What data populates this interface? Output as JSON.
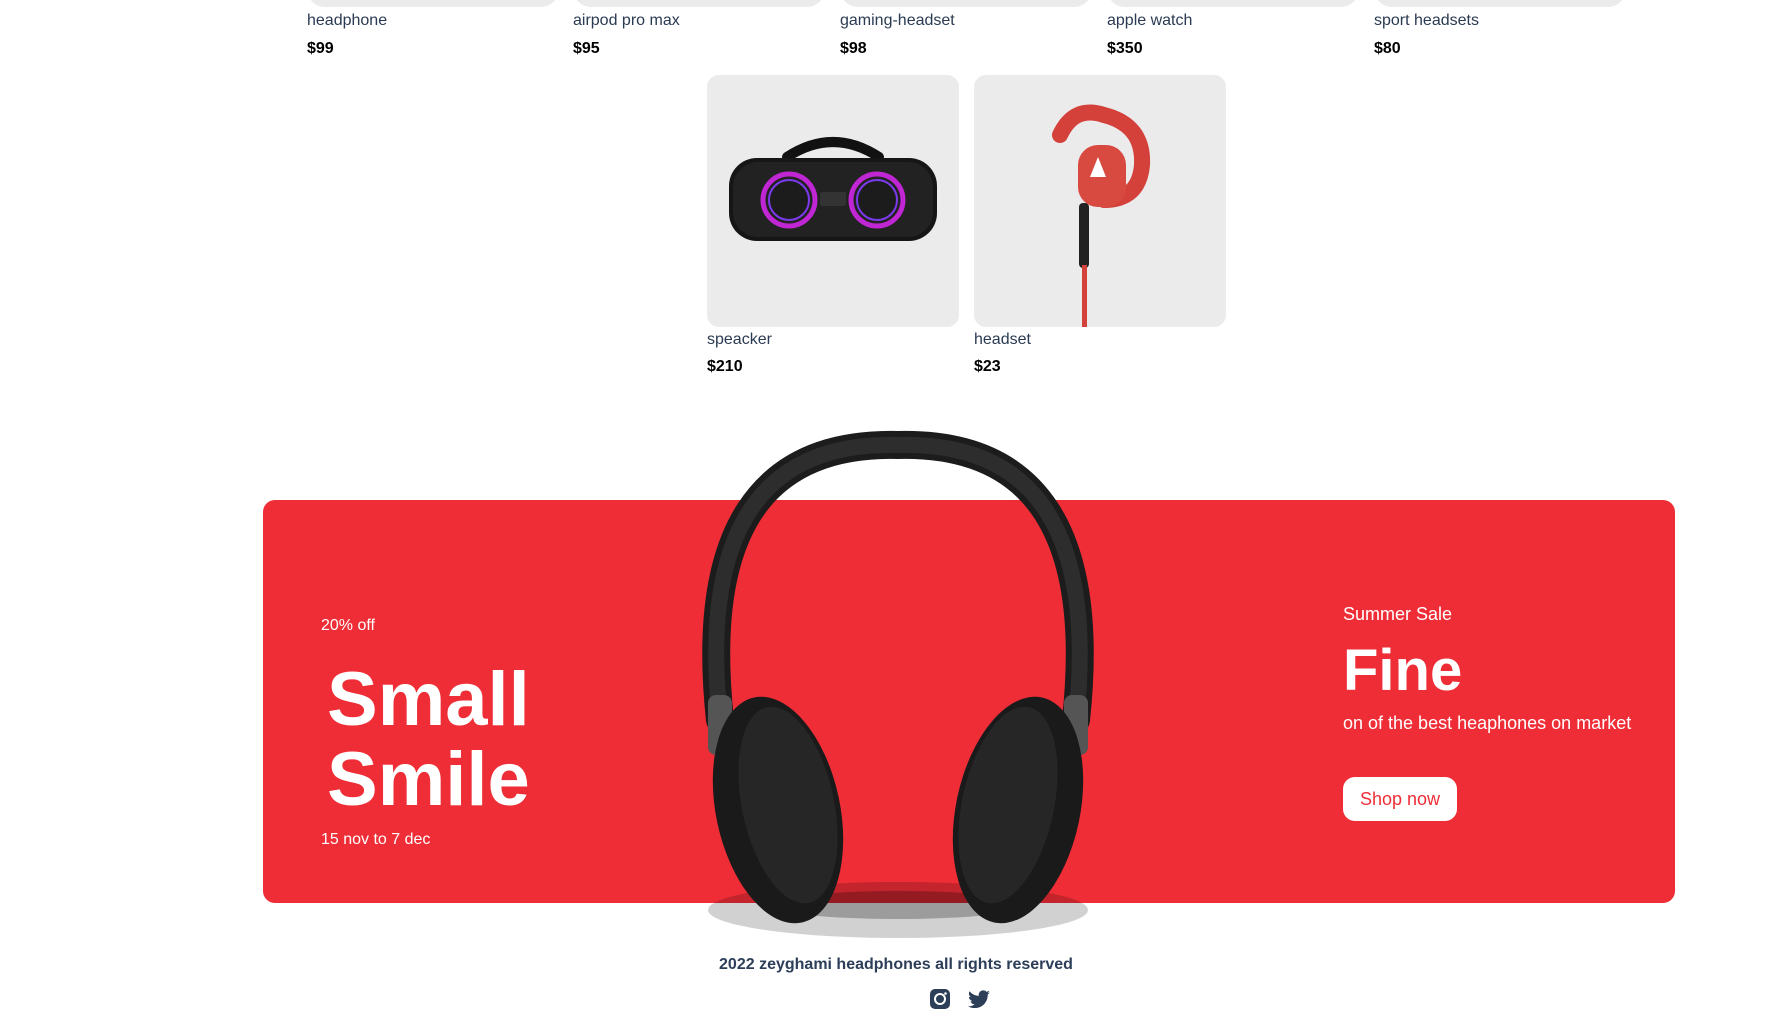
{
  "products_top": [
    {
      "name": "headphone",
      "price": "$99"
    },
    {
      "name": "airpod pro max",
      "price": "$95"
    },
    {
      "name": "gaming-headset",
      "price": "$98"
    },
    {
      "name": "apple watch",
      "price": "$350"
    },
    {
      "name": "sport headsets",
      "price": "$80"
    }
  ],
  "products_row2": [
    {
      "name": "speacker",
      "price": "$210"
    },
    {
      "name": "headset",
      "price": "$23"
    }
  ],
  "banner": {
    "discount": "20% off",
    "headline_line1": "Small",
    "headline_line2": "Smile",
    "dates": "15 nov to 7 dec",
    "sale_label": "Summer Sale",
    "sale_title": "Fine",
    "sale_desc": "on of the best heaphones on market",
    "cta": "Shop now",
    "color": "#ef2d36"
  },
  "footer": {
    "copyright": "2022 zeyghami headphones all rights reserved",
    "icons": [
      "instagram-icon",
      "twitter-icon"
    ]
  }
}
